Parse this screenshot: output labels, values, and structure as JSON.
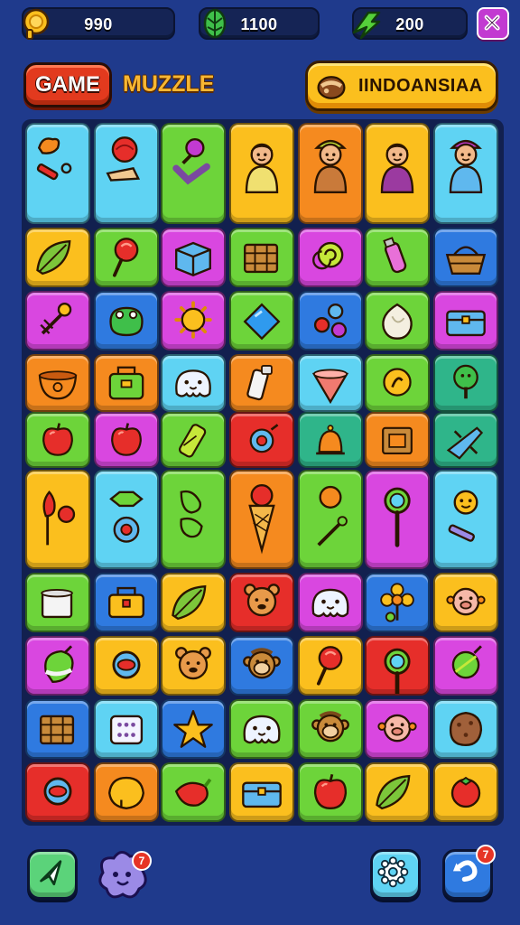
{
  "resources": {
    "coins": "990",
    "gems": "1100",
    "energy": "200"
  },
  "header": {
    "game_label": "GAME",
    "subtitle": "MUZZLE",
    "region_label": "IINDOANSIAA"
  },
  "bottom_bar": {
    "hint_badge": "7",
    "undo_badge": "7"
  },
  "icons": {
    "coin": "coin-icon",
    "gem": "leaf-gem-icon",
    "energy": "energy-icon",
    "close": "close-icon",
    "hint": "paper-plane-icon",
    "character": "ghost-character-icon",
    "settings": "gear-icon",
    "undo": "undo-icon"
  },
  "colors": {
    "background": "#1f3a8c",
    "accent": "#fbbf1e",
    "game_badge": "#e23a1e"
  },
  "board": {
    "columns": 7,
    "tiles": [
      {
        "color": "#5fd3f3",
        "item": "leaf-scroll"
      },
      {
        "color": "#5fd3f3",
        "item": "red-ball-fan"
      },
      {
        "color": "#6dd43a",
        "item": "plum-pipe"
      },
      {
        "color": "#fbbf1e",
        "item": "person-boy"
      },
      {
        "color": "#f58a1f",
        "item": "person-farmer"
      },
      {
        "color": "#fbbf1e",
        "item": "person-girl"
      },
      {
        "color": "#5fd3f3",
        "item": "person-hat"
      },
      {
        "color": "#fbbf1e",
        "item": "leaf"
      },
      {
        "color": "#6dd43a",
        "item": "lollipop"
      },
      {
        "color": "#d947e0",
        "item": "box"
      },
      {
        "color": "#6dd43a",
        "item": "crate"
      },
      {
        "color": "#d947e0",
        "item": "swirl"
      },
      {
        "color": "#6dd43a",
        "item": "bottle"
      },
      {
        "color": "#2f7ae0",
        "item": "basket"
      },
      {
        "color": "#d947e0",
        "item": "flower-whisk"
      },
      {
        "color": "#2f7ae0",
        "item": "frog"
      },
      {
        "color": "#d947e0",
        "item": "sun"
      },
      {
        "color": "#6dd43a",
        "item": "diamond"
      },
      {
        "color": "#2f7ae0",
        "item": "berries"
      },
      {
        "color": "#6dd43a",
        "item": "onion"
      },
      {
        "color": "#d947e0",
        "item": "chest"
      },
      {
        "color": "#f58a1f",
        "item": "bowl"
      },
      {
        "color": "#f58a1f",
        "item": "bag"
      },
      {
        "color": "#5fd3f3",
        "item": "ghost"
      },
      {
        "color": "#f58a1f",
        "item": "cup"
      },
      {
        "color": "#5fd3f3",
        "item": "cone"
      },
      {
        "color": "#6dd43a",
        "item": "coin"
      },
      {
        "color": "#2fb58a",
        "item": "tree"
      },
      {
        "color": "#6dd43a",
        "item": "apple"
      },
      {
        "color": "#d947e0",
        "item": "apple"
      },
      {
        "color": "#6dd43a",
        "item": "battery"
      },
      {
        "color": "#e62e2a",
        "item": "ring"
      },
      {
        "color": "#2fb58a",
        "item": "bell"
      },
      {
        "color": "#f58a1f",
        "item": "frame"
      },
      {
        "color": "#2fb58a",
        "item": "plane"
      },
      {
        "color": "#fbbf1e",
        "item": "cherry"
      },
      {
        "color": "#5fd3f3",
        "item": "candy"
      },
      {
        "color": "#6dd43a",
        "item": "peppers"
      },
      {
        "color": "#f58a1f",
        "item": "icecream"
      },
      {
        "color": "#6dd43a",
        "item": "orange-pin"
      },
      {
        "color": "#d947e0",
        "item": "magnifier"
      },
      {
        "color": "#5fd3f3",
        "item": "sunface"
      },
      {
        "color": "#6dd43a",
        "item": "pot"
      },
      {
        "color": "#2f7ae0",
        "item": "lunchbox"
      },
      {
        "color": "#fbbf1e",
        "item": "leaf"
      },
      {
        "color": "#e62e2a",
        "item": "bear"
      },
      {
        "color": "#d947e0",
        "item": "ghost"
      },
      {
        "color": "#2f7ae0",
        "item": "flower"
      },
      {
        "color": "#fbbf1e",
        "item": "pig"
      },
      {
        "color": "#d947e0",
        "item": "bulb"
      },
      {
        "color": "#fbbf1e",
        "item": "lens"
      },
      {
        "color": "#fbbf1e",
        "item": "bear"
      },
      {
        "color": "#2f7ae0",
        "item": "monkey"
      },
      {
        "color": "#fbbf1e",
        "item": "lollipop"
      },
      {
        "color": "#e62e2a",
        "item": "magnifier"
      },
      {
        "color": "#d947e0",
        "item": "lime"
      },
      {
        "color": "#2f7ae0",
        "item": "crate"
      },
      {
        "color": "#5fd3f3",
        "item": "dice"
      },
      {
        "color": "#2f7ae0",
        "item": "star"
      },
      {
        "color": "#6dd43a",
        "item": "ghost"
      },
      {
        "color": "#6dd43a",
        "item": "monkey"
      },
      {
        "color": "#d947e0",
        "item": "pig"
      },
      {
        "color": "#5fd3f3",
        "item": "cookie"
      },
      {
        "color": "#e62e2a",
        "item": "lens"
      },
      {
        "color": "#f58a1f",
        "item": "lemon"
      },
      {
        "color": "#6dd43a",
        "item": "pepper"
      },
      {
        "color": "#fbbf1e",
        "item": "chest"
      },
      {
        "color": "#6dd43a",
        "item": "apple"
      },
      {
        "color": "#fbbf1e",
        "item": "leaf"
      },
      {
        "color": "#fbbf1e",
        "item": "tomato"
      }
    ]
  }
}
